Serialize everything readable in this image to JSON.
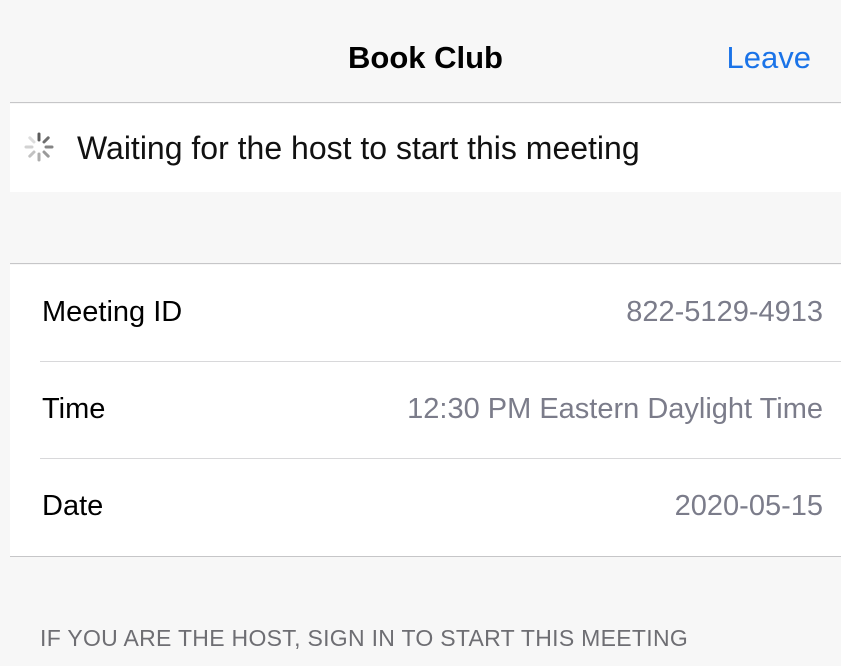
{
  "navbar": {
    "title": "Book Club",
    "leave_label": "Leave"
  },
  "status": {
    "icon": "loading-spinner-icon",
    "text": "Waiting for the host to start this meeting"
  },
  "details": [
    {
      "label": "Meeting ID",
      "value": "822-5129-4913"
    },
    {
      "label": "Time",
      "value": "12:30 PM Eastern Daylight Time"
    },
    {
      "label": "Date",
      "value": "2020-05-15"
    }
  ],
  "footer": {
    "host_note": "IF YOU ARE THE HOST, SIGN IN TO START THIS MEETING"
  },
  "colors": {
    "accent": "#1a73e8",
    "value_text": "#7b7c8a",
    "background": "#f7f7f7",
    "separator": "#c6c6c8"
  }
}
